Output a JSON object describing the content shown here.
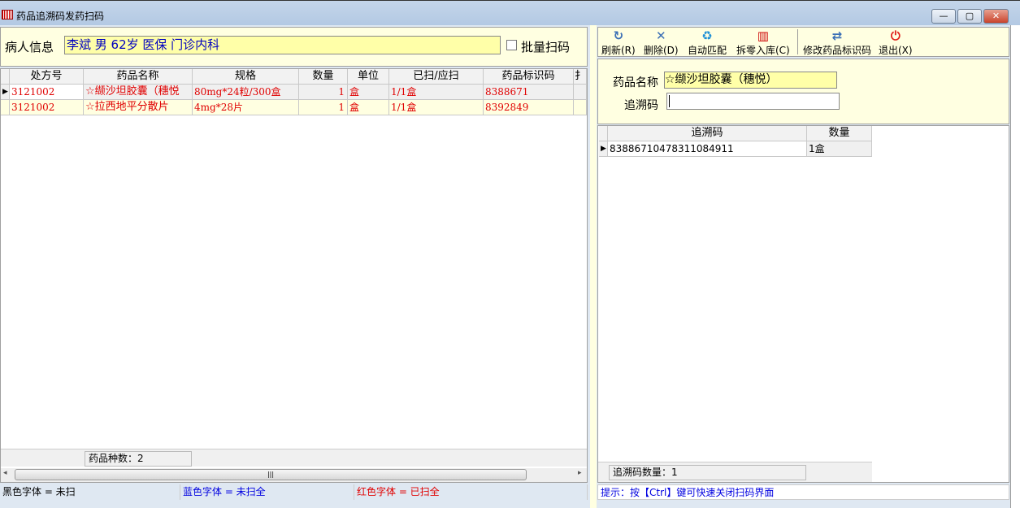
{
  "window": {
    "title": "药品追溯码发药扫码",
    "icon": "barcode-icon",
    "minimize": "—",
    "maximize": "▢",
    "close": "✕"
  },
  "patient": {
    "label": "病人信息",
    "value": "李斌 男 62岁 医保 门诊内科",
    "batch_scan_label": "批量扫码",
    "batch_scan_checked": false
  },
  "left_grid": {
    "columns": [
      "处方号",
      "药品名称",
      "规格",
      "数量",
      "单位",
      "已扫/应扫",
      "药品标识码",
      "扌"
    ],
    "rows": [
      [
        "3121002",
        "☆缬沙坦胶囊（穗悦",
        "80mg*24粒/300盒",
        "1",
        "盒",
        "1/1盒",
        "8388671",
        ""
      ],
      [
        "3121002",
        "☆拉西地平分散片",
        "4mg*28片",
        "1",
        "盒",
        "1/1盒",
        "8392849",
        ""
      ]
    ],
    "footer": "药品种数：2"
  },
  "legend": {
    "black": "黑色字体 = 未扫",
    "blue": "蓝色字体 = 未扫全",
    "red": "红色字体 = 已扫全"
  },
  "toolbar": [
    {
      "label": "刷新(R)",
      "icon": "refresh-icon"
    },
    {
      "label": "删除(D)",
      "icon": "delete-icon"
    },
    {
      "label": "自动匹配",
      "icon": "recycle-icon"
    },
    {
      "label": "拆零入库(C)",
      "icon": "barcode-icon"
    },
    {
      "label": "修改药品标识码",
      "icon": "swap-icon"
    },
    {
      "label": "退出(X)",
      "icon": "power-icon"
    }
  ],
  "form": {
    "drug_name_label": "药品名称",
    "drug_name_value": "☆缬沙坦胶囊（穗悦）",
    "trace_code_label": "追溯码",
    "trace_code_value": ""
  },
  "right_grid": {
    "columns": [
      "追溯码",
      "数量"
    ],
    "rows": [
      [
        "83886710478311084911",
        "1盒"
      ]
    ],
    "footer": "追溯码数量：1"
  },
  "hint": "提示：按【Ctrl】键可快速关闭扫码界面",
  "colors": {
    "red": "#e00000",
    "blue": "#0000e0",
    "panel_yellow": "#ffffe1",
    "input_yellow": "#ffffa8"
  }
}
